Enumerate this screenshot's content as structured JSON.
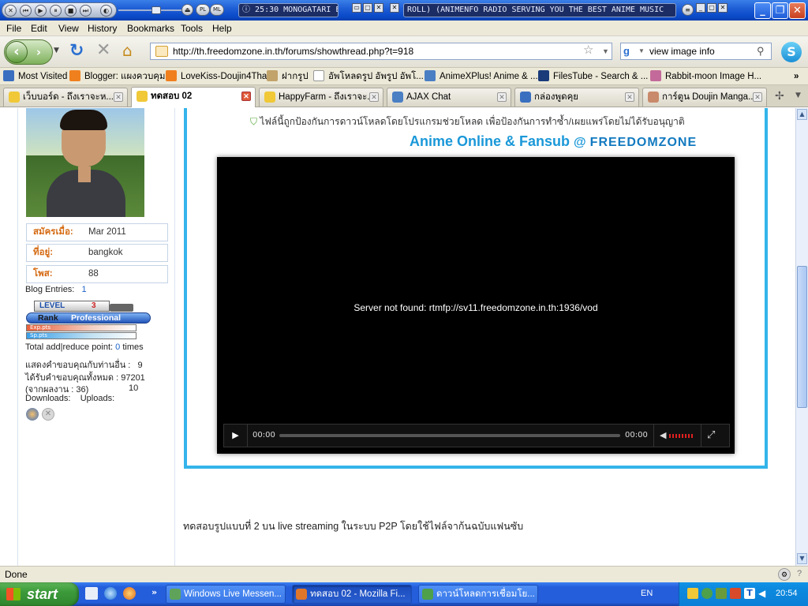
{
  "titlebar": {
    "media_time": "25:30  MONOGATARI E",
    "radio_text": " ROLL) (ANIMENFO RADIO   SERVING YOU THE BEST ANIME MUSIC",
    "media_labels": {
      "pl": "PL",
      "ml": "ML"
    }
  },
  "menu": [
    "File",
    "Edit",
    "View",
    "History",
    "Bookmarks",
    "Tools",
    "Help"
  ],
  "nav": {
    "url": "http://th.freedomzone.in.th/forums/showthread.php?t=918",
    "search": "view image info"
  },
  "bookmarks": [
    {
      "label": "Most Visited",
      "color": "#3a6fc0"
    },
    {
      "label": "Blogger: แผงควบคุม",
      "color": "#f0801e"
    },
    {
      "label": "LoveKiss-Doujin4Thai",
      "color": "#f0801e"
    },
    {
      "label": "ฝากรูป",
      "color": "#c2a36a"
    },
    {
      "label": "อัพโหลดรูป อัพรูป อัพโ...",
      "color": "#ffffff"
    },
    {
      "label": "AnimeXPlus! Anime & ...",
      "color": "#4a7fc4"
    },
    {
      "label": "FilesTube - Search & ...",
      "color": "#1a3a7a"
    },
    {
      "label": "Rabbit-moon Image H...",
      "color": "#c46a9a"
    }
  ],
  "tabs": [
    {
      "label": "เว็บบอร์ด - ถึงเราจะห...",
      "color": "#f0c838"
    },
    {
      "label": "ทดสอบ 02",
      "color": "#f0c838",
      "active": true
    },
    {
      "label": "HappyFarm - ถึงเราจะ...",
      "color": "#f0c838"
    },
    {
      "label": "AJAX Chat",
      "color": "#4a7fc4"
    },
    {
      "label": "กล่องพูดคุย",
      "color": "#3a6fc0"
    },
    {
      "label": "การ์ตูน Doujin Manga...",
      "color": "#c88a6a"
    }
  ],
  "profile": {
    "fields": [
      {
        "key": "สมัครเมื่อ:",
        "value": "Mar 2011"
      },
      {
        "key": "ที่อยู่:",
        "value": "bangkok"
      },
      {
        "key": "โพส:",
        "value": "88"
      }
    ],
    "blog_entries_label": "Blog Entries:",
    "blog_entries": "1",
    "level_label": "LEVEL",
    "level": "3",
    "rank_label": "Rank",
    "rank": "Professional",
    "exp_label": "Exp.pts",
    "sp_label": "Sp.pts",
    "points_label": "Total add|reduce point:",
    "points": "0",
    "points_unit": "times",
    "thanks_given_label": "แสดงคำขอบคุณกับท่านอื่น :",
    "thanks_given": "9",
    "thanks_received_label": "ได้รับคำขอบคุณทั้งหมด : 97201",
    "thanks_posts_label": "(จากผลงาน : 36)",
    "thanks_posts_value": "10",
    "downloads_label": "Downloads:",
    "uploads_label": "Uploads:"
  },
  "post": {
    "notice": "ไฟล์นี้ถูกป้องกันการดาวน์โหลดโดยโปรแกรมช่วยโหลด เพื่อป้องกันการทำซ้ำ/เผยแพร่โดยไม่ได้รับอนุญาติ",
    "banner_main": "Anime Online & Fansub",
    "banner_at": "@",
    "banner_site": "FREEDOMZONE",
    "player_message": "Server not found: rtmfp://sv11.freedomzone.in.th:1936/vod",
    "time_current": "00:00",
    "time_total": "00:00",
    "description": "ทดสอบรูปแบบที่ 2 บน live streaming ในระบบ P2P โดยใช้ไฟล์จาก้นฉบับแฟนซับ"
  },
  "status": "Done",
  "taskbar": {
    "start": "start",
    "tasks": [
      {
        "label": "Windows Live Messen...",
        "color": "#5fa35a"
      },
      {
        "label": "ทดสอบ 02 - Mozilla Fi...",
        "color": "#e0762a",
        "active": true
      },
      {
        "label": "ดาวน์โหลดการเชื่อมโย...",
        "color": "#4ea04a"
      }
    ],
    "lang": "EN",
    "clock": "20:54"
  }
}
